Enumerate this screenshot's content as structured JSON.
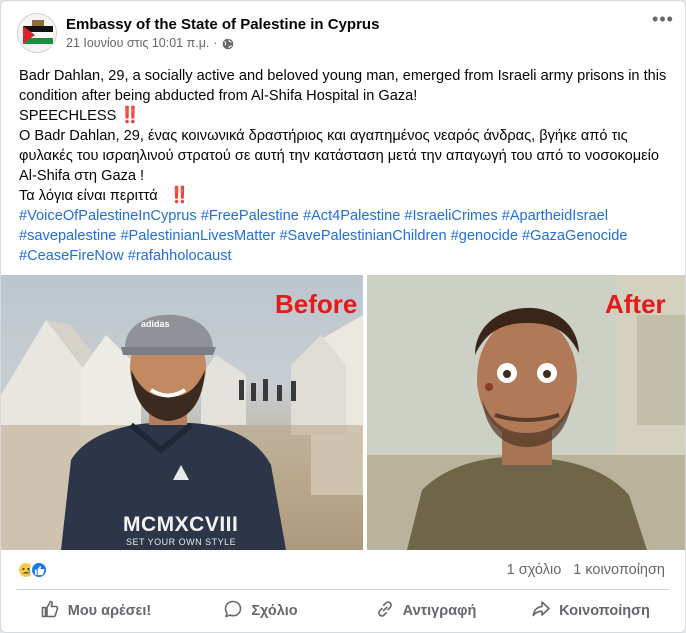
{
  "post": {
    "page_name": "Embassy of the State of Palestine in Cyprus",
    "timestamp": "21 Ιουνίου στις 10:01 π.μ.",
    "separator": "·",
    "privacy_icon": "globe-icon",
    "more_icon": "more-icon",
    "text": {
      "en_line": "Badr Dahlan, 29, a socially active and beloved young man, emerged from Israeli army prisons in this condition after being abducted from Al-Shifa Hospital in Gaza!",
      "speechless": "SPEECHLESS",
      "speechless_emoji": "‼️",
      "gr_line": "Ο Badr Dahlan, 29, ένας κοινωνικά δραστήριος και αγαπημένος νεαρός άνδρας, βγήκε από τις φυλακές του ισραηλινού στρατού σε αυτή την κατάσταση μετά την απαγωγή του από το νοσοκομείο Al-Shifa στη Gaza !",
      "gr_words": "Τα λόγια είναι περιττά",
      "gr_words_emoji": "‼️"
    },
    "hashtags": [
      "#VoiceOfPalestineInCyprus",
      "#FreePalestine",
      "#Act4Palestine",
      "#IsraeliCrimes",
      "#ApartheidIsrael",
      "#savepalestine",
      "#PalestinianLivesMatter",
      "#SavePalestinianChildren",
      "#genocide",
      "#GazaGenocide",
      "#CeaseFireNow",
      "#rafahholocaust"
    ],
    "photos": {
      "left_label": "Before",
      "right_label": "After",
      "cap_text": "adidas",
      "shirt_text": "MCMXCVIII",
      "shirt_subtext": "SET YOUR OWN STYLE"
    },
    "stats": {
      "reaction_icons": [
        "sad-reaction-icon",
        "like-reaction-icon"
      ],
      "comments": "1 σχόλιο",
      "shares": "1 κοινοποίηση"
    },
    "actions": {
      "like": "Μου αρέσει!",
      "comment": "Σχόλιο",
      "copy": "Αντιγραφή",
      "share": "Κοινοποίηση"
    }
  },
  "colors": {
    "hashtag": "#216fdb",
    "label_red": "#e31b1b",
    "secondary_text": "#65676b",
    "like_blue": "#1877f2"
  }
}
